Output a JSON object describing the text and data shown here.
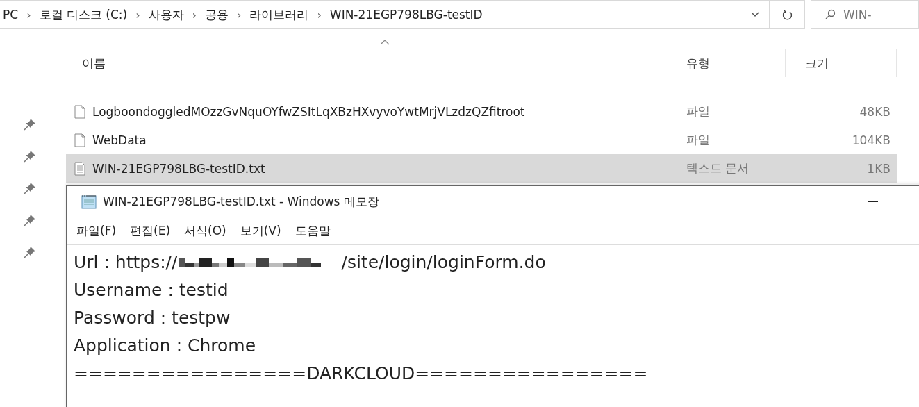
{
  "address_bar": {
    "separator": "›",
    "path": [
      {
        "label": "PC"
      },
      {
        "label": "로컬 디스크 (C:)"
      },
      {
        "label": "사용자"
      },
      {
        "label": "공용"
      },
      {
        "label": "라이브러리"
      },
      {
        "label": "WIN-21EGP798LBG-testID"
      }
    ],
    "search": {
      "value": "WIN-"
    }
  },
  "columns": [
    {
      "label": "이름",
      "sorted": true
    },
    {
      "label": "유형",
      "sorted": false
    },
    {
      "label": "크기",
      "sorted": false
    }
  ],
  "files": [
    {
      "name": "LogboondoggledMOzzGvNquOYfwZSItLqXBzHXvyvoYwtMrjVLzdzQZfitroot",
      "type": "파일",
      "size": "48KB",
      "kind": "file",
      "selected": false
    },
    {
      "name": "WebData",
      "type": "파일",
      "size": "104KB",
      "kind": "file",
      "selected": false
    },
    {
      "name": "WIN-21EGP798LBG-testID.txt",
      "type": "텍스트 문서",
      "size": "1KB",
      "kind": "text",
      "selected": true
    }
  ],
  "notepad": {
    "title": "WIN-21EGP798LBG-testID.txt - Windows 메모장",
    "menu": [
      {
        "label": "파일(F)"
      },
      {
        "label": "편집(E)"
      },
      {
        "label": "서식(O)"
      },
      {
        "label": "보기(V)"
      },
      {
        "label": "도움말"
      }
    ],
    "lines": [
      {
        "kind": "redacted_url",
        "before": "Url : https://",
        "after": "/site/login/loginForm.do"
      },
      {
        "kind": "text",
        "text": "Username : testid"
      },
      {
        "kind": "text",
        "text": "Password : testpw"
      },
      {
        "kind": "text",
        "text": "Application : Chrome"
      },
      {
        "kind": "text",
        "text": "================DARKCLOUD================"
      }
    ]
  }
}
